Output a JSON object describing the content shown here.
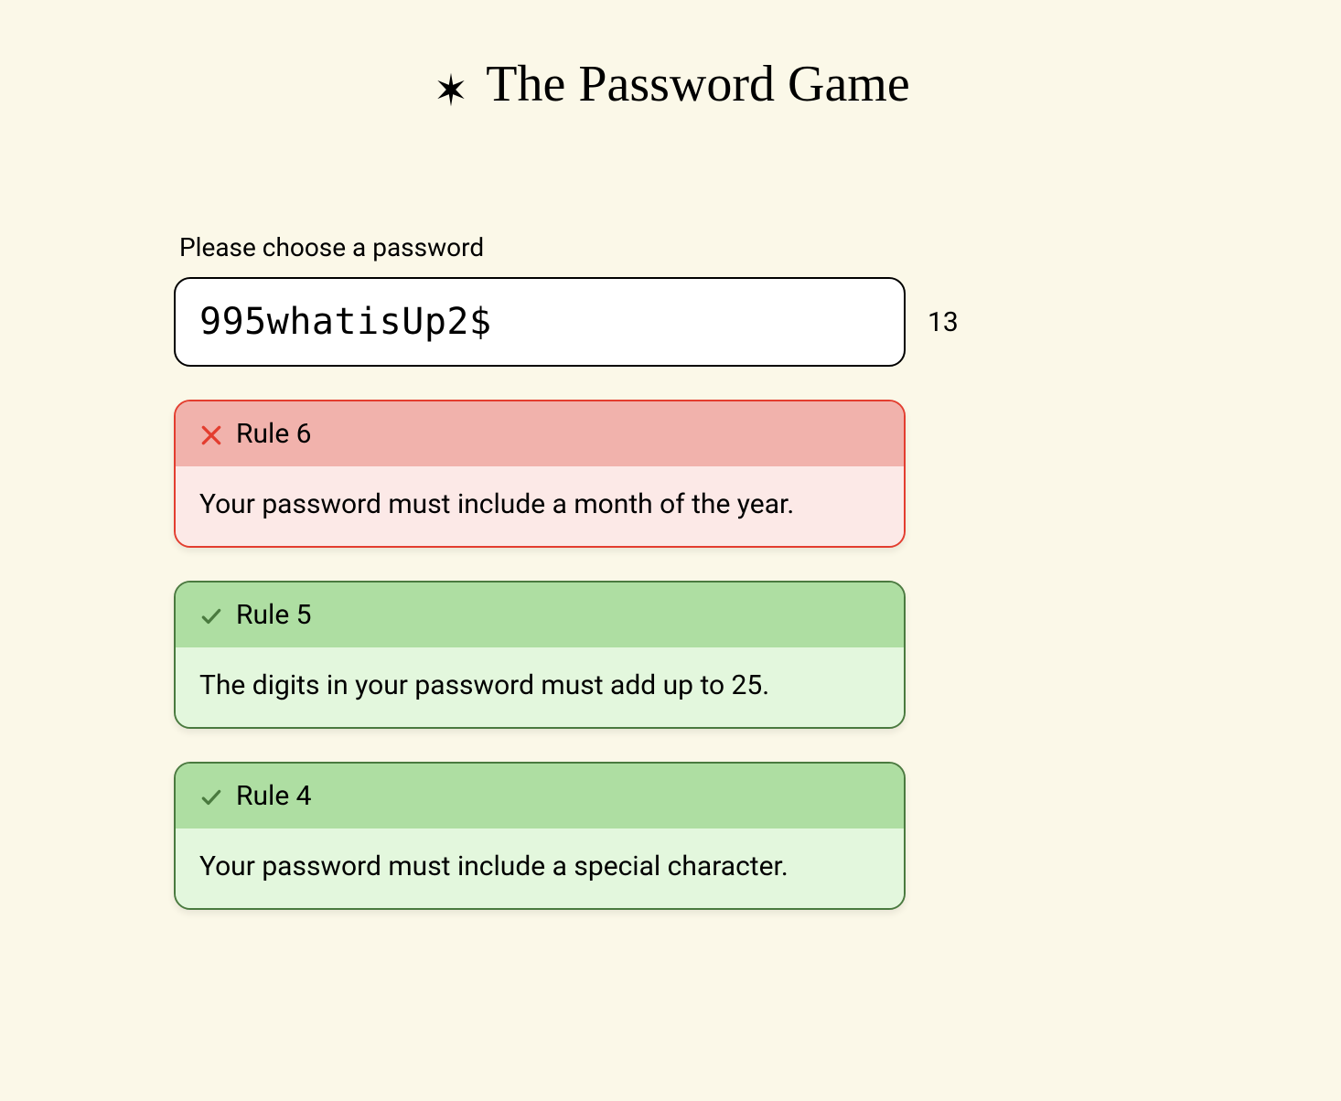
{
  "header": {
    "title": "The Password Game"
  },
  "prompt": {
    "label": "Please choose a password"
  },
  "input": {
    "value": "995whatisUp2$",
    "char_count": "13"
  },
  "rules": [
    {
      "status": "fail",
      "title": "Rule 6",
      "text": "Your password must include a month of the year."
    },
    {
      "status": "pass",
      "title": "Rule 5",
      "text": "The digits in your password must add up to 25."
    },
    {
      "status": "pass",
      "title": "Rule 4",
      "text": "Your password must include a special character."
    }
  ]
}
